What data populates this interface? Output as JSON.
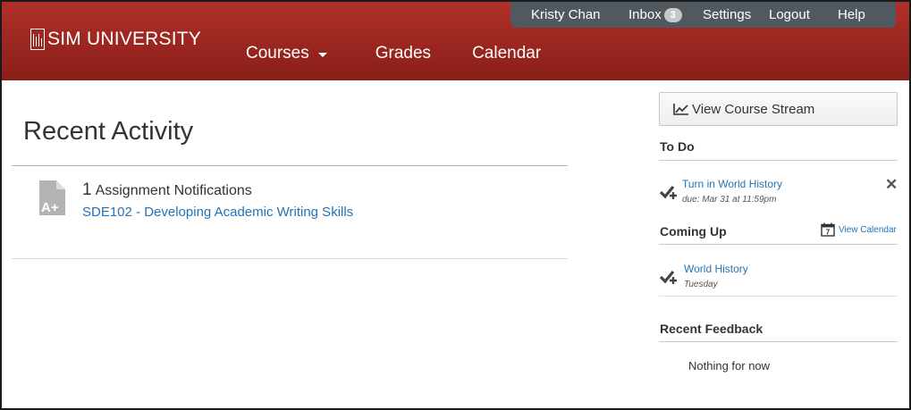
{
  "brand": {
    "name": "SIM UNIVERSITY"
  },
  "main_nav": {
    "courses": "Courses",
    "grades": "Grades",
    "calendar": "Calendar"
  },
  "user_nav": {
    "user_name": "Kristy Chan",
    "inbox": "Inbox",
    "inbox_count": "3",
    "settings": "Settings",
    "logout": "Logout",
    "help": "Help"
  },
  "main": {
    "title": "Recent Activity",
    "activity": {
      "count": "1",
      "label": "Assignment Notifications",
      "course_link": "SDE102 - Developing Academic Writing Skills",
      "icon": "assignment-grade-icon"
    }
  },
  "sidebar": {
    "stream_button": "View Course Stream",
    "todo": {
      "heading": "To Do",
      "items": [
        {
          "title": "Turn in World History",
          "due": "due: Mar 31 at 11:59pm"
        }
      ]
    },
    "coming_up": {
      "heading": "Coming Up",
      "view_calendar": "View Calendar",
      "calendar_icon_day": "7",
      "items": [
        {
          "title": "World History",
          "when": "Tuesday"
        }
      ]
    },
    "recent_feedback": {
      "heading": "Recent Feedback",
      "empty_text": "Nothing for now"
    }
  },
  "colors": {
    "header_red": "#9b2620",
    "user_nav_bg": "#505860",
    "link_blue": "#2473b6"
  }
}
